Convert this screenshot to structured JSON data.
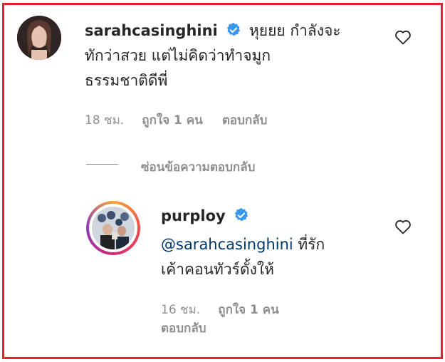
{
  "comment": {
    "username": "sarahcasinghini",
    "text_line1": "หุยยย กำลังจะ",
    "text_line2": "ทักว่าสวย แต่ไม่คิดว่าทำจมูก",
    "text_line3": "ธรรมชาติดีพี่",
    "time": "18 ชม.",
    "likes": "ถูกใจ 1 คน",
    "reply": "ตอบกลับ"
  },
  "hide_replies": "ซ่อนข้อความตอบกลับ",
  "reply_comment": {
    "username": "purploy",
    "mention": "@sarahcasinghini",
    "text_line1": " ที่รัก",
    "text_line2": "เค้าคอนทัวร์ดั้งให้",
    "time": "16 ชม.",
    "likes": "ถูกใจ 1 คน",
    "reply": "ตอบกลับ"
  },
  "colors": {
    "frame": "#e8202a",
    "verified": "#3897f0",
    "muted": "#8e8e8e",
    "mention": "#00376b"
  },
  "icons": [
    "verified-badge-icon",
    "heart-icon"
  ]
}
